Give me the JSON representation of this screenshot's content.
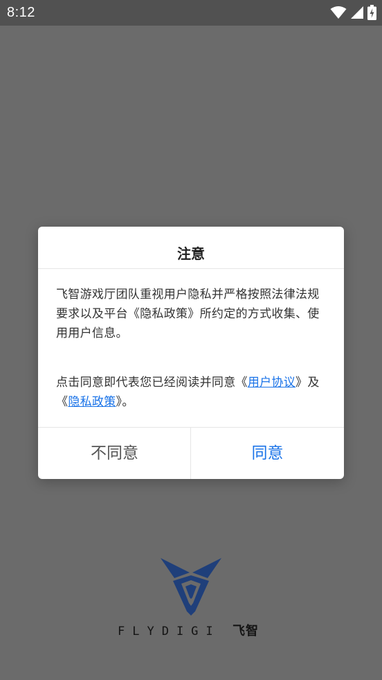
{
  "status_bar": {
    "time": "8:12"
  },
  "dialog": {
    "title": "注意",
    "paragraph1": "飞智游戏厅团队重视用户隐私并严格按照法律法规要求以及平台《隐私政策》所约定的方式收集、使用用户信息。",
    "paragraph2_prefix": "点击同意即代表您已经阅读并同意《",
    "user_agreement_link": "用户协议",
    "paragraph2_middle": "》及《",
    "privacy_policy_link": "隐私政策",
    "paragraph2_suffix": "》。",
    "decline_label": "不同意",
    "agree_label": "同意"
  },
  "brand": {
    "english": "FLYDIGI",
    "chinese": "飞智"
  },
  "colors": {
    "overlay": "#6b6b6b",
    "status_bar": "#515151",
    "accent": "#1a73e8",
    "logo_blue": "#1f3f7a"
  },
  "icons": [
    "wifi-icon",
    "signal-icon",
    "battery-charging-icon"
  ]
}
